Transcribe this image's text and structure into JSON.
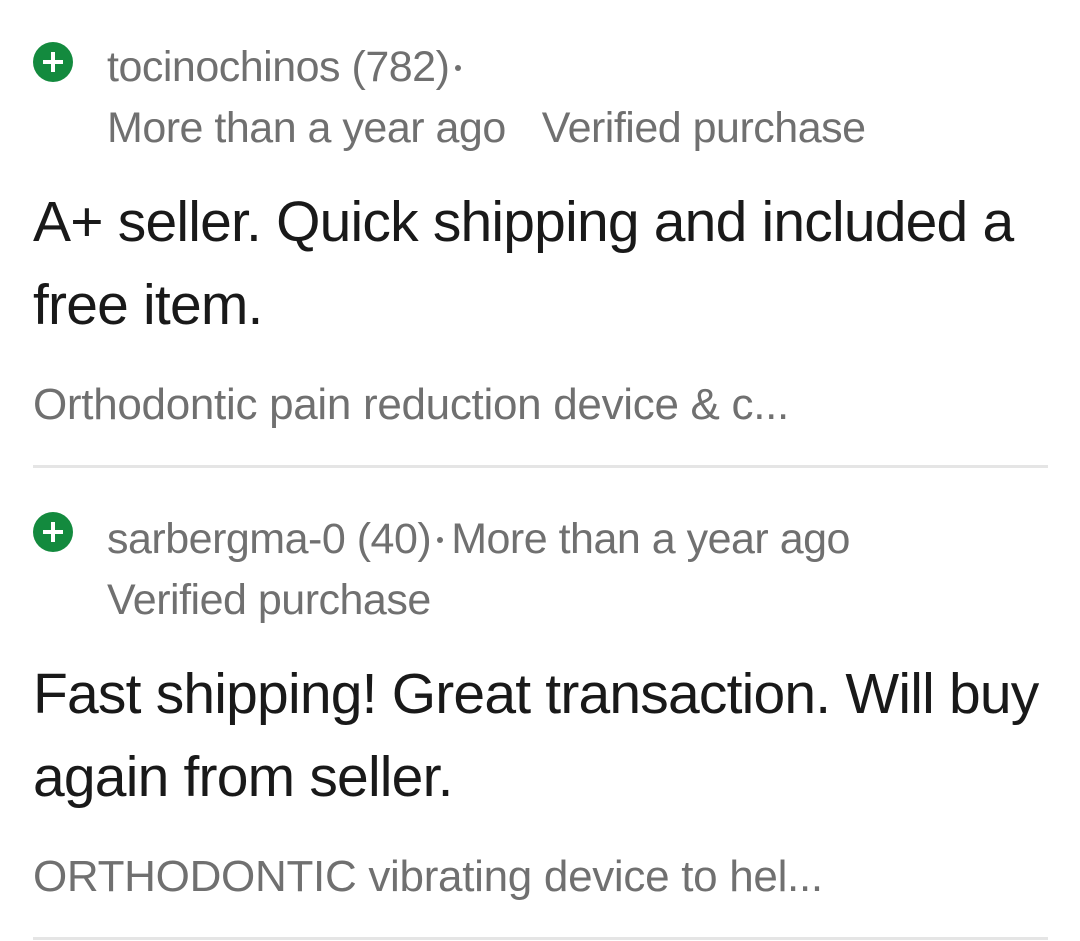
{
  "reviews": [
    {
      "username": "tocinochinos",
      "score": "(782)",
      "time": "More than a year ago",
      "verified": "Verified purchase",
      "comment": "A+ seller. Quick shipping and included a free item.",
      "item": "Orthodontic pain reduction device & c..."
    },
    {
      "username": "sarbergma-0",
      "score": "(40)",
      "time": "More than a year ago",
      "verified": "Verified purchase",
      "comment": "Fast shipping! Great transaction. Will buy again from seller.",
      "item": "ORTHODONTIC vibrating device to hel..."
    }
  ],
  "colors": {
    "positive_icon": "#138a3e",
    "meta_text": "#707070",
    "body_text": "#191919",
    "divider": "#e5e5e5"
  },
  "icons": {
    "rating": "positive-plus-icon"
  }
}
